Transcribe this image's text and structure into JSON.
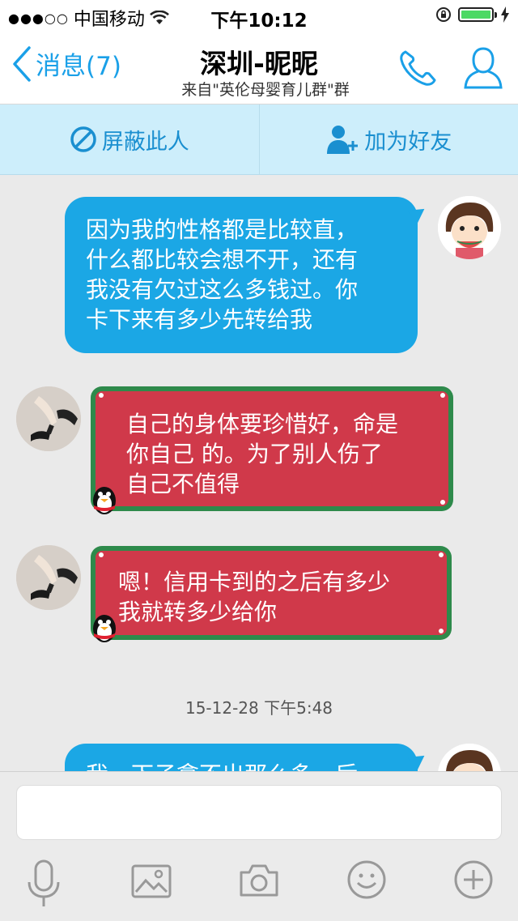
{
  "status_bar": {
    "signal": "●●●○○",
    "carrier": "中国移动",
    "time": "下午10:12"
  },
  "nav": {
    "back_label": "消息(7)",
    "title": "深圳-昵昵",
    "subtitle": "来自\"英伦母婴育儿群\"群"
  },
  "actions": {
    "block_label": "屏蔽此人",
    "add_friend_label": "加为好友"
  },
  "messages": [
    {
      "side": "right",
      "lines": [
        "因为我的性格都是比较直，",
        "什么都比较会想不开，还有",
        "我没有欠过这么多钱过。你",
        "卡下来有多少先转给我"
      ]
    },
    {
      "side": "left",
      "lines": [
        "自己的身体要珍惜好，命是",
        "你自己 的。为了别人伤了",
        "自己不值得"
      ]
    },
    {
      "side": "left",
      "lines": [
        "嗯！信用卡到的之后有多少",
        "我就转多少给你"
      ]
    },
    {
      "side": "right",
      "lines": [
        "我，下子拿不出那么多，后"
      ]
    }
  ],
  "timestamp": "15-12-28 下午5:48",
  "colors": {
    "accent": "#1aa0e8",
    "bubble_blue": "#1ba7e5",
    "bubble_red": "#d0394a",
    "bubble_border_green": "#2e8a4b",
    "battery_green": "#4cd964"
  },
  "icons": [
    "wifi-icon",
    "lock-rotation-icon",
    "battery-icon",
    "charging-icon",
    "back-chevron-icon",
    "phone-icon",
    "profile-icon",
    "block-icon",
    "add-friend-icon",
    "microphone-icon",
    "image-icon",
    "camera-icon",
    "emoji-icon",
    "plus-icon"
  ]
}
